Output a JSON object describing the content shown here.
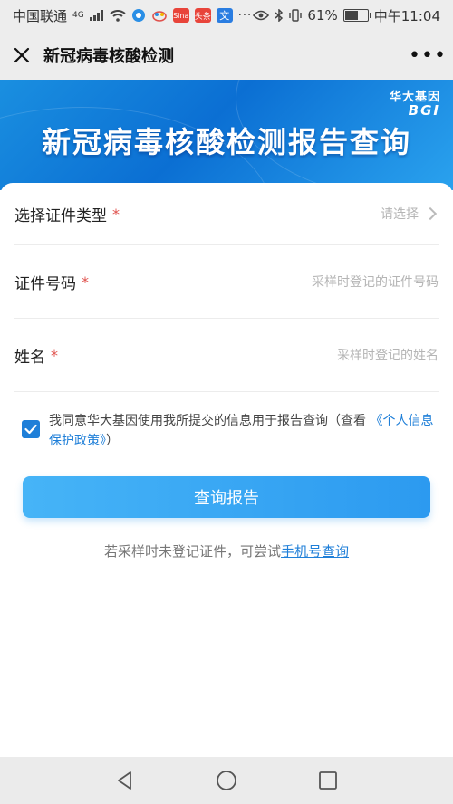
{
  "status_bar": {
    "carrier": "中国联通",
    "network": "4G",
    "battery_percent": "61%",
    "battery_level": 0.61,
    "time": "中午11:04",
    "app_badges": [
      {
        "name": "app-badge-sina",
        "text": "Sina",
        "color": "#e8443a"
      },
      {
        "name": "app-badge-toutiao",
        "text": "头条",
        "color": "#e8443a"
      },
      {
        "name": "app-badge-wen",
        "text": "文",
        "color": "#2a7de1"
      }
    ]
  },
  "nav": {
    "title": "新冠病毒核酸检测",
    "more_label": "•••"
  },
  "banner": {
    "brand_cn": "华大基因",
    "brand_en": "BGI",
    "title": "新冠病毒核酸检测报告查询"
  },
  "form": {
    "id_type": {
      "label": "选择证件类型",
      "required_mark": "*",
      "placeholder": "请选择"
    },
    "id_number": {
      "label": "证件号码",
      "required_mark": "*",
      "placeholder": "采样时登记的证件号码"
    },
    "name": {
      "label": "姓名",
      "required_mark": "*",
      "placeholder": "采样时登记的姓名"
    }
  },
  "agreement": {
    "checked": true,
    "text_before": "我同意华大基因使用我所提交的信息用于报告查询（查看 ",
    "link_text": "《个人信息保护政策》",
    "text_after": "）"
  },
  "submit_label": "查询报告",
  "alt_hint": {
    "text": "若采样时未登记证件，可尝试",
    "link_text": "手机号查询"
  },
  "colors": {
    "accent": "#1f7fd8",
    "required": "#e0524d",
    "button_start": "#46b4f7",
    "button_end": "#2c9af0"
  }
}
